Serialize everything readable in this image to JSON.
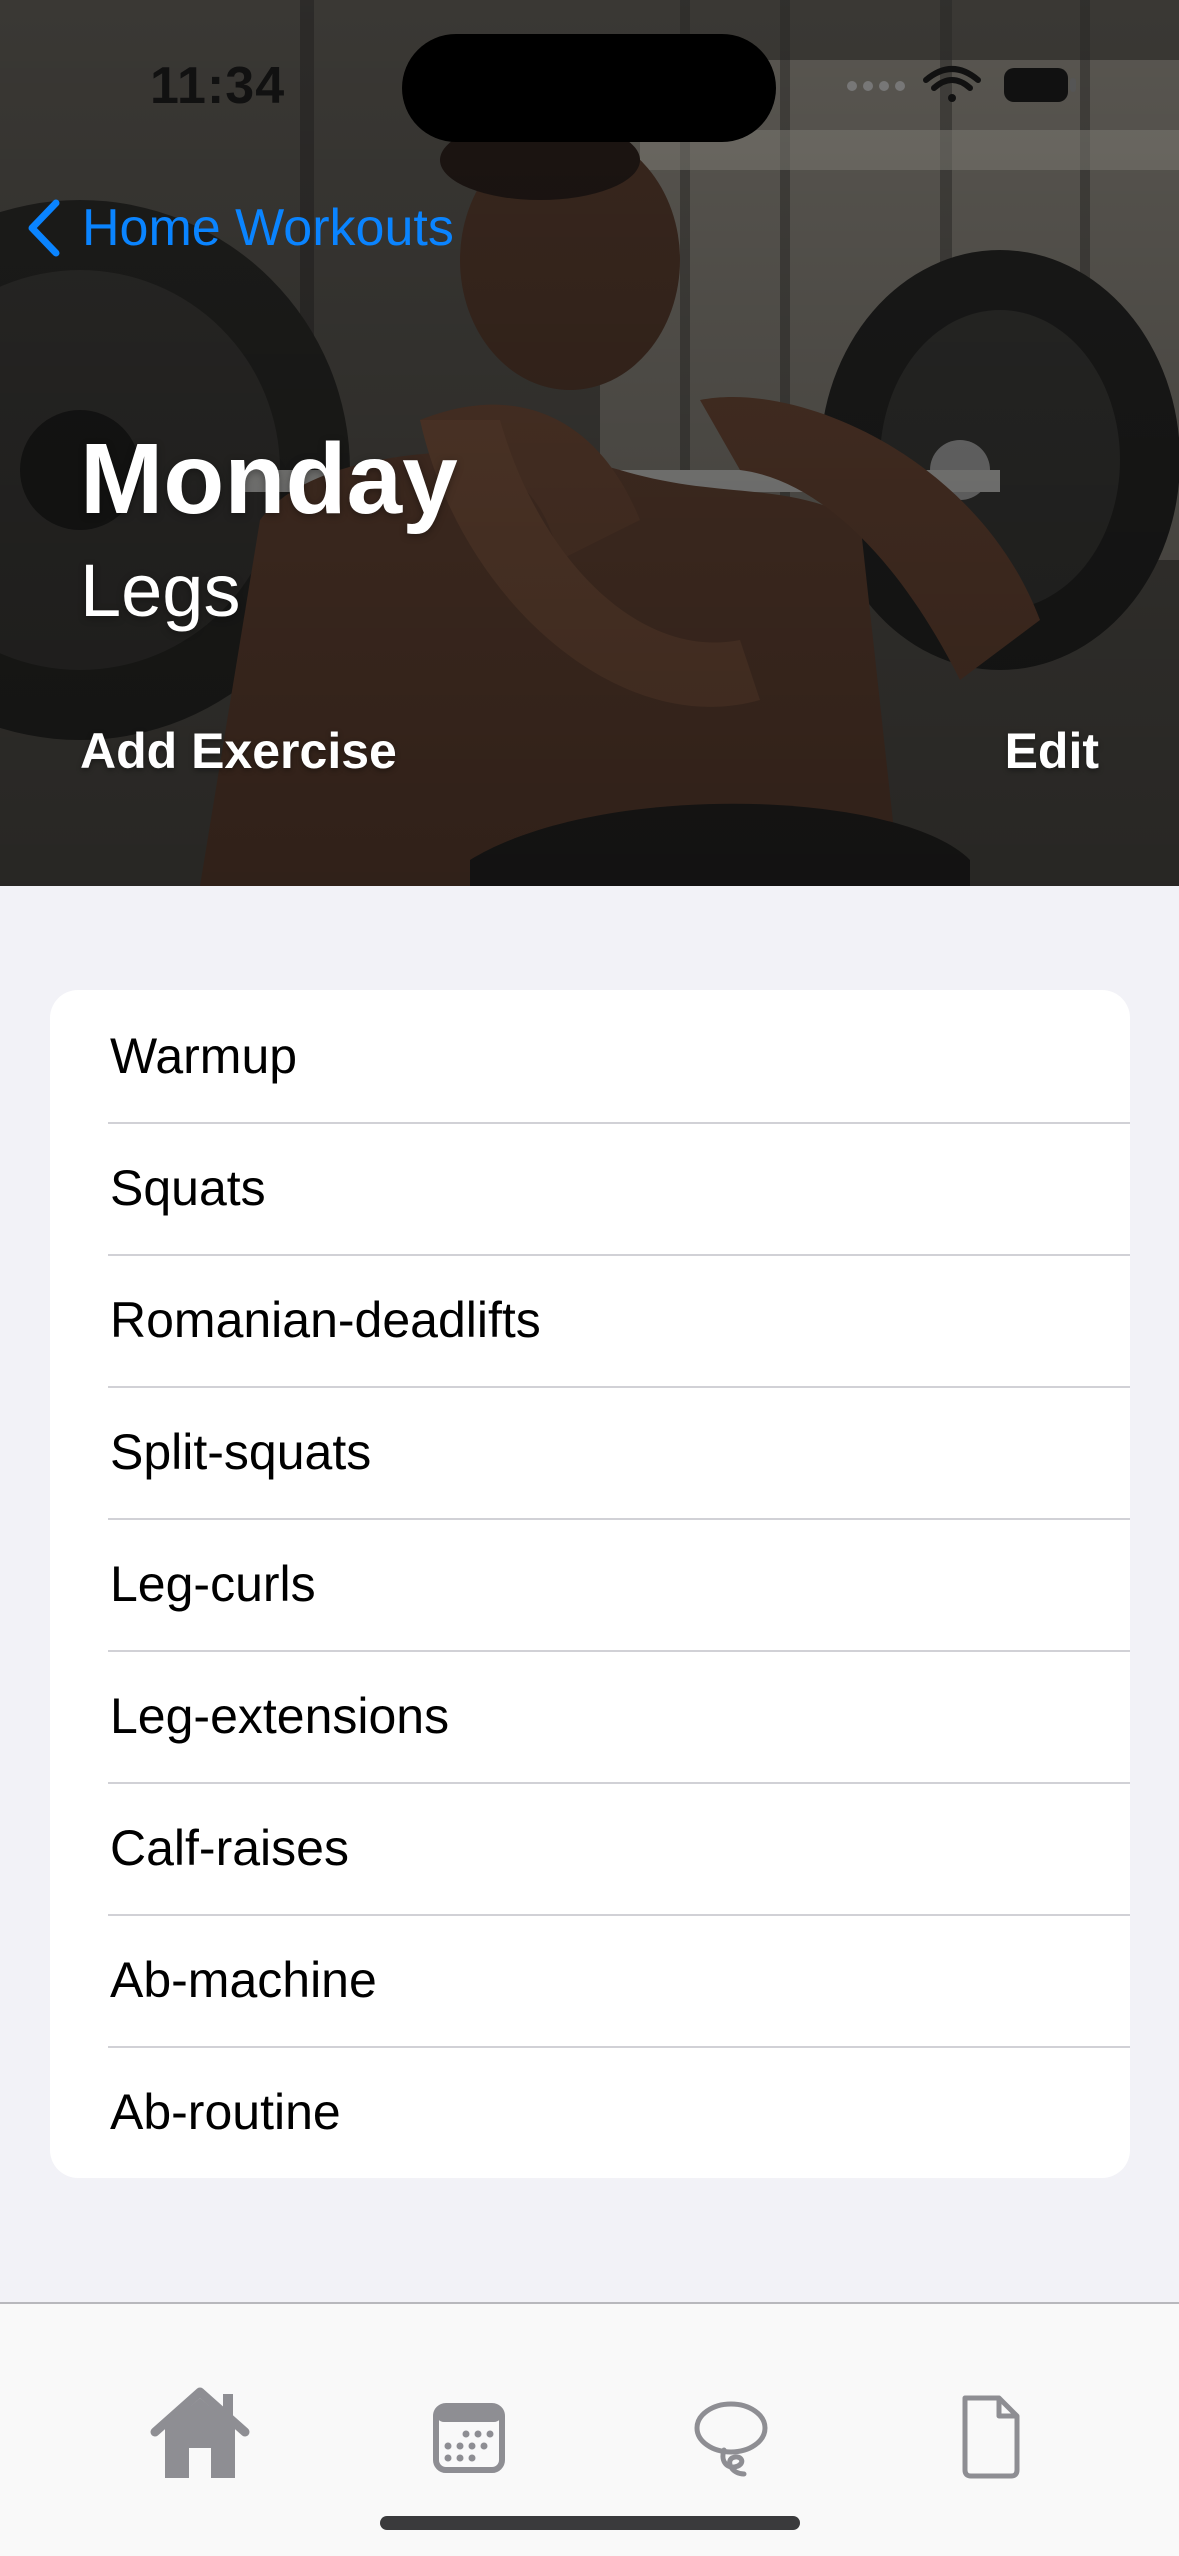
{
  "status_bar": {
    "time": "11:34"
  },
  "nav": {
    "back_label": "Home Workouts"
  },
  "header": {
    "title": "Monday",
    "subtitle": "Legs",
    "add_exercise_label": "Add Exercise",
    "edit_label": "Edit"
  },
  "exercises": [
    "Warmup",
    "Squats",
    "Romanian-deadlifts",
    "Split-squats",
    "Leg-curls",
    "Leg-extensions",
    "Calf-raises",
    "Ab-machine",
    "Ab-routine"
  ],
  "tabbar": {
    "tabs": [
      {
        "name": "home",
        "icon": "house-icon",
        "active": true
      },
      {
        "name": "calendar",
        "icon": "calendar-icon",
        "active": false
      },
      {
        "name": "chat",
        "icon": "lasso-icon",
        "active": false
      },
      {
        "name": "document",
        "icon": "doc-icon",
        "active": false
      }
    ]
  },
  "colors": {
    "accent": "#0a84ff",
    "background": "#f2f2f7",
    "tab_active": "#8e8e93",
    "tab_inactive": "#8e8e93"
  }
}
